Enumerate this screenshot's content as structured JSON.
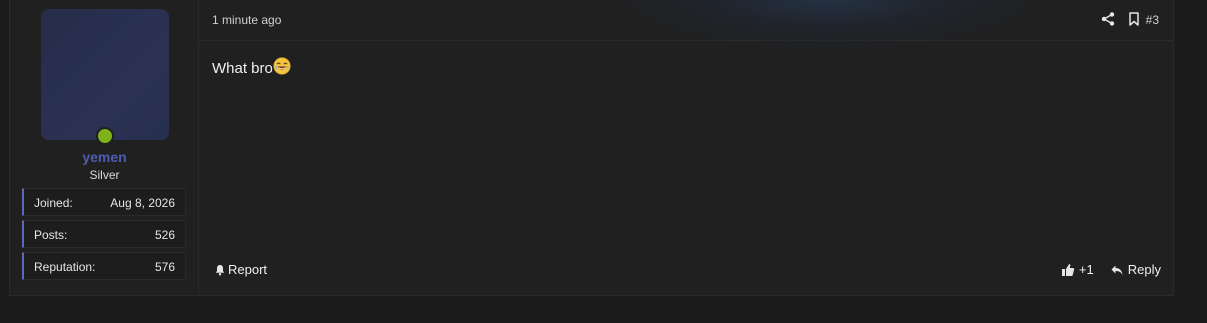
{
  "post": {
    "timestamp": "1 minute ago",
    "post_number": "#3",
    "message": "What bro",
    "message_emoji": "laughing-crying-emoji"
  },
  "user": {
    "username": "yemen",
    "title": "Silver",
    "online": true,
    "stats": [
      {
        "label": "Joined:",
        "value": "Aug 8, 2026"
      },
      {
        "label": "Posts:",
        "value": "526"
      },
      {
        "label": "Reputation:",
        "value": "576"
      }
    ]
  },
  "actions": {
    "report_label": "Report",
    "like_label": "+1",
    "reply_label": "Reply"
  },
  "icons": {
    "share": "share-icon",
    "bookmark": "bookmark-icon",
    "report": "bell-icon",
    "like": "thumbs-up-icon",
    "reply": "reply-arrow-icon"
  },
  "colors": {
    "username": "#4f5cb5",
    "stat_accent": "#5b67b9",
    "online": "#7fb21a"
  }
}
